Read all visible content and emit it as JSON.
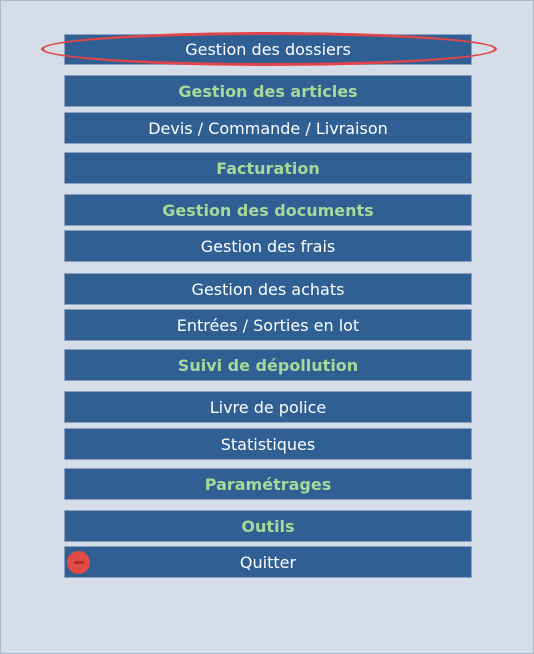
{
  "menu": {
    "items": [
      {
        "label": "Gestion des dossiers",
        "style": "normal"
      },
      {
        "label": "Gestion des articles",
        "style": "section"
      },
      {
        "label": "Devis / Commande / Livraison",
        "style": "normal"
      },
      {
        "label": "Facturation",
        "style": "section"
      },
      {
        "label": "Gestion des documents",
        "style": "section"
      },
      {
        "label": "Gestion des frais",
        "style": "normal"
      },
      {
        "label": "Gestion des achats",
        "style": "normal"
      },
      {
        "label": "Entrées / Sorties en lot",
        "style": "normal"
      },
      {
        "label": "Suivi de dépollution",
        "style": "section"
      },
      {
        "label": "Livre de police",
        "style": "normal"
      },
      {
        "label": "Statistiques",
        "style": "normal"
      },
      {
        "label": "Paramétrages",
        "style": "section"
      },
      {
        "label": "Outils",
        "style": "section"
      },
      {
        "label": "Quitter",
        "style": "normal",
        "icon": "stop-icon"
      }
    ],
    "highlighted_item": "Gestion des dossiers"
  },
  "colors": {
    "background": "#d5dde8",
    "button": "#2f5f93",
    "button_text": "#ffffff",
    "section_text": "#a8d89a",
    "highlight": "#e0454a",
    "quit_icon": "#e24a45"
  }
}
